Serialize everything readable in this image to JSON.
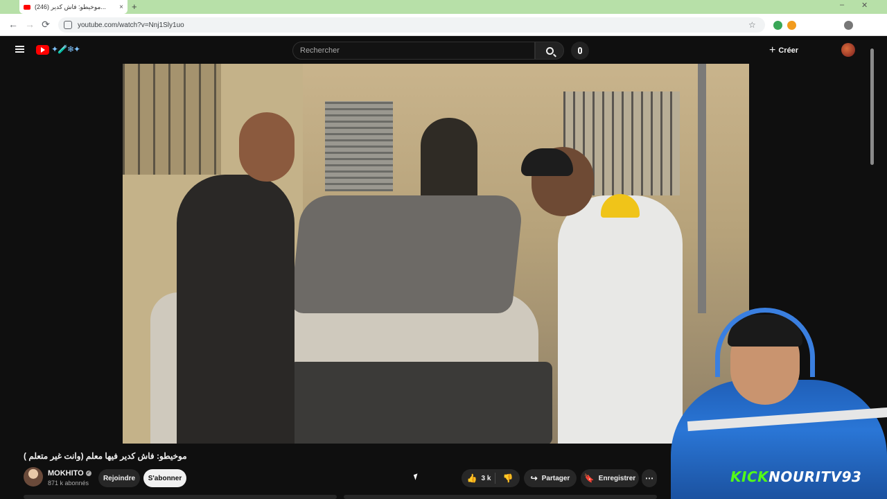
{
  "browser": {
    "tab_title": "(246) موخيطو: فاش كدير...",
    "tab_close": "×",
    "new_tab": "+",
    "url": "youtube.com/watch?v=Nnj1Sly1uo",
    "back": "←",
    "forward": "→",
    "reload": "⟳",
    "star": "☆",
    "minimize": "–",
    "close": "✕"
  },
  "header": {
    "search_placeholder": "Rechercher",
    "create_label": "Créer",
    "create_plus": "+",
    "logo_doodle": "✦🧪❄✦"
  },
  "video": {
    "title": "موخيطو: فاش كدير فيها معلم (وانت غير متعلم )",
    "webcam_watermark_kick": "KICK",
    "webcam_watermark_name": "NOURITV93"
  },
  "channel": {
    "name": "MOKHITO",
    "verified": "✓",
    "subscribers": "871 k abonnés",
    "join_label": "Rejoindre",
    "subscribe_label": "S'abonner"
  },
  "actions": {
    "like_icon": "👍",
    "likes": "3 k",
    "dislike_icon": "👎",
    "share_icon": "↪",
    "share_label": "Partager",
    "save_icon": "🔖",
    "save_label": "Enregistrer",
    "more_icon": "⋯"
  },
  "colors": {
    "background": "#0f0f0f",
    "youtube_red": "#ff0000",
    "kick_green": "#53fc18",
    "tab_strip": "#b7e0a8"
  }
}
